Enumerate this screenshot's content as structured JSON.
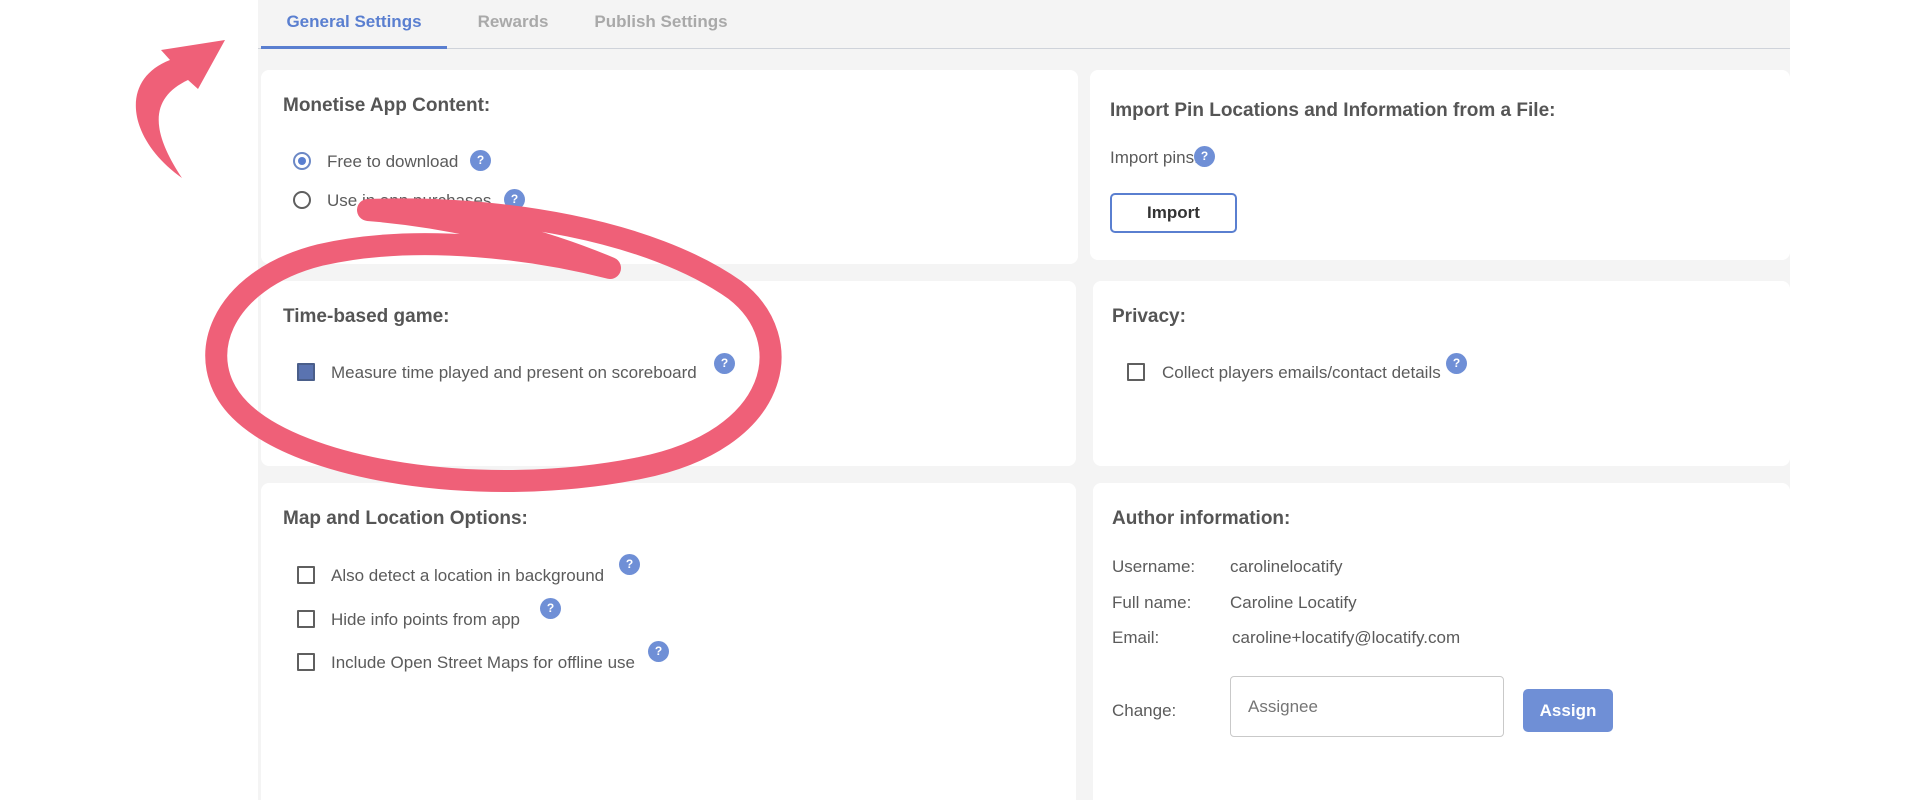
{
  "tabs": [
    {
      "label": "General Settings",
      "active": true
    },
    {
      "label": "Rewards",
      "active": false
    },
    {
      "label": "Publish Settings",
      "active": false
    }
  ],
  "monetise": {
    "title": "Monetise App Content:",
    "options": [
      {
        "label": "Free to download",
        "selected": true
      },
      {
        "label": "Use in app purchases",
        "selected": false
      }
    ]
  },
  "import": {
    "title": "Import Pin Locations and Information from a File:",
    "label": "Import pins:",
    "button": "Import"
  },
  "time_game": {
    "title": "Time-based game:",
    "option": {
      "label": "Measure time played and present on scoreboard",
      "checked": true
    }
  },
  "privacy": {
    "title": "Privacy:",
    "option": {
      "label": "Collect players emails/contact details",
      "checked": false
    }
  },
  "map": {
    "title": "Map and Location Options:",
    "options": [
      {
        "label": "Also detect a location in background",
        "checked": false
      },
      {
        "label": "Hide info points from app",
        "checked": false
      },
      {
        "label": "Include Open Street Maps for offline use",
        "checked": false
      }
    ]
  },
  "author": {
    "title": "Author information:",
    "username_label": "Username:",
    "username": "carolinelocatify",
    "fullname_label": "Full name:",
    "fullname": "Caroline Locatify",
    "email_label": "Email:",
    "email": "caroline+locatify@locatify.com",
    "change_label": "Change:",
    "assignee_placeholder": "Assignee",
    "assign_button": "Assign"
  },
  "help_glyph": "?",
  "colors": {
    "accent": "#5a7fd0",
    "help_badge": "#6f8fd6",
    "annotation": "#ef6078",
    "panel_bg": "#f4f4f4",
    "card_bg": "#ffffff"
  },
  "icons": {
    "help": "question-circle-icon",
    "annotation_arrow": "curved-arrow-icon",
    "annotation_circle": "highlight-ellipse"
  }
}
